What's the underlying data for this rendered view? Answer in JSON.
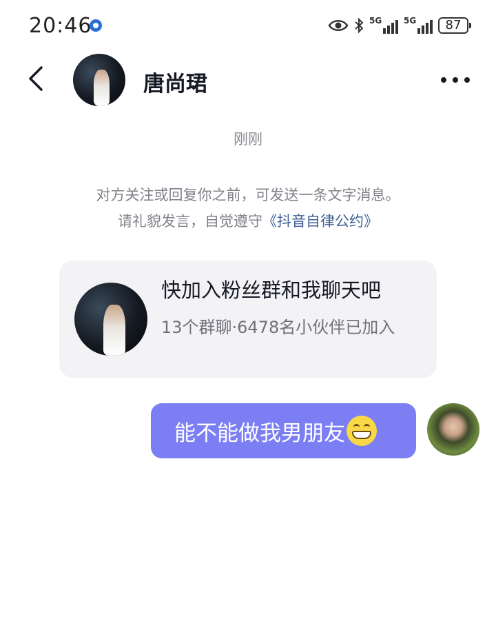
{
  "status_bar": {
    "time": "20:46",
    "signal1": "5G",
    "signal2": "5G",
    "battery": "87",
    "icons": [
      "location-icon",
      "eye-icon",
      "bluetooth-icon",
      "signal-icon",
      "signal-icon",
      "battery-icon"
    ]
  },
  "header": {
    "contact_name": "唐尚珺",
    "back_icon": "chevron-left-icon",
    "more_icon": "more-dots-icon"
  },
  "chat": {
    "timestamp": "刚刚",
    "notice_line1": "对方关注或回复你之前，可发送一条文字消息。",
    "notice_line2_prefix": "请礼貌发言，自觉遵守",
    "notice_link": "《抖音自律公约》",
    "group_card": {
      "title": "快加入粉丝群和我聊天吧",
      "subtitle": "13个群聊·6478名小伙伴已加入"
    },
    "my_message": {
      "text": "能不能做我男朋友",
      "emoji": "grin-emoji"
    }
  },
  "colors": {
    "bubble": "#7b7ff3",
    "link": "#3f5f94",
    "card_bg": "#f3f3f6",
    "secondary_text": "#80818a"
  }
}
